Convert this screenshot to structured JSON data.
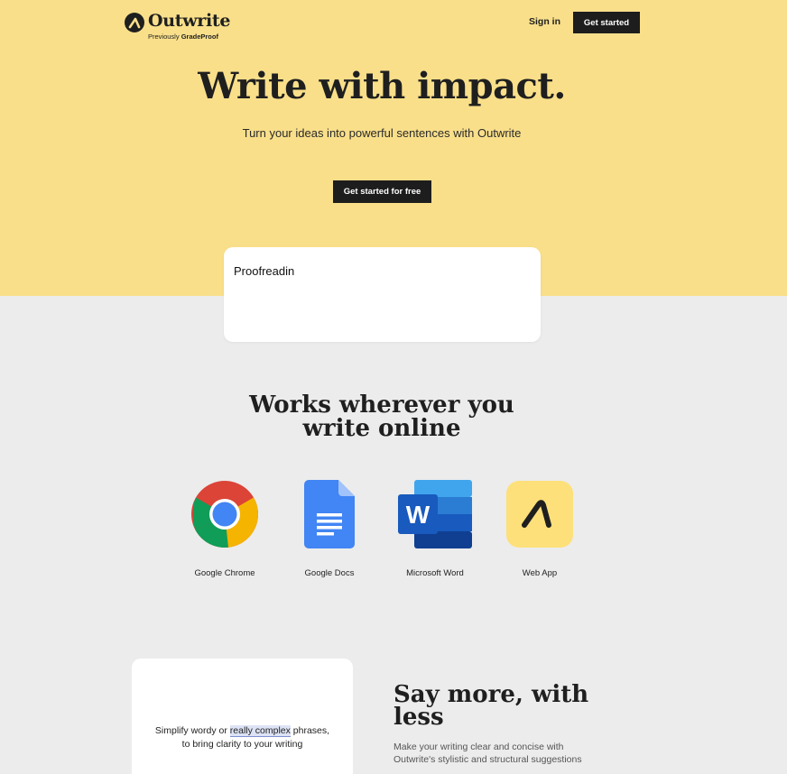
{
  "header": {
    "logo_name": "Outwrite",
    "logo_sub_prefix": "Previously ",
    "logo_sub_brand": "GradeProof",
    "signin": "Sign in",
    "get_started": "Get started"
  },
  "hero": {
    "title": "Write with impact.",
    "subtitle": "Turn your ideas into powerful sentences with Outwrite",
    "cta": "Get started for free"
  },
  "editor": {
    "text": "Proofreadin"
  },
  "works": {
    "title_line1": "Works wherever you",
    "title_line2": "write online",
    "apps": [
      {
        "label": "Google Chrome",
        "icon": "chrome-icon"
      },
      {
        "label": "Google Docs",
        "icon": "google-docs-icon"
      },
      {
        "label": "Microsoft Word",
        "icon": "microsoft-word-icon"
      },
      {
        "label": "Web App",
        "icon": "outwrite-app-icon"
      }
    ]
  },
  "feature": {
    "card_before": "Simplify wordy or ",
    "card_highlight": "really complex",
    "card_after": " phrases,",
    "card_line2": "to bring clarity to your writing",
    "title_line1": "Say more, with",
    "title_line2": "less",
    "subtitle_line1": "Make your writing clear and concise with",
    "subtitle_line2": "Outwrite's stylistic and structural suggestions"
  },
  "colors": {
    "hero_bg": "#f9df8a",
    "page_bg": "#ececec",
    "button_dark": "#1d1d1d",
    "webapp_icon_bg": "#fde07a"
  }
}
